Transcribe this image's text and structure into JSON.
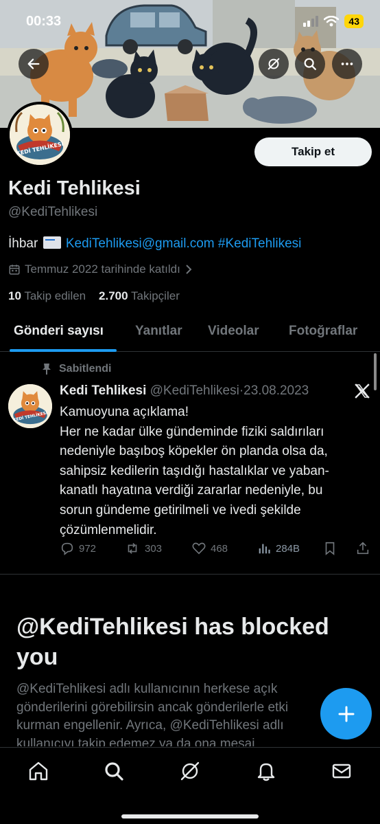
{
  "status_bar": {
    "time": "00:33",
    "battery": "43"
  },
  "profile": {
    "display_name": "Kedi Tehlikesi",
    "handle": "@KediTehlikesi",
    "bio_prefix": "İhbar",
    "bio_email": "KediTehlikesi@gmail.com",
    "bio_hashtag": "#KediTehlikesi",
    "joined": "Temmuz 2022 tarihinde katıldı",
    "following_count": "10",
    "following_label": "Takip edilen",
    "followers_count": "2.700",
    "followers_label": "Takipçiler",
    "follow_button": "Takip et",
    "avatar_logo_text": "KEDİ TEHLİKESİ"
  },
  "tabs": [
    {
      "label": "Gönderi sayısı",
      "active": true
    },
    {
      "label": "Yanıtlar",
      "active": false
    },
    {
      "label": "Videolar",
      "active": false
    },
    {
      "label": "Fotoğraflar",
      "active": false
    }
  ],
  "tweet": {
    "pinned_label": "Sabitlendi",
    "author_name": "Kedi Tehlikesi",
    "author_handle": "@KediTehlikesi",
    "separator": "·",
    "date": "23.08.2023",
    "lines": [
      "Kamuoyuna açıklama!",
      "Her ne kadar ülke gündeminde fiziki saldırıları",
      "nedeniyle başıboş köpekler ön planda olsa da,",
      "sahipsiz kedilerin taşıdığı hastalıklar ve yaban-",
      "kanatlı hayatına verdiği zararlar nedeniyle, bu",
      "sorun gündeme getirilmeli ve ivedi şekilde",
      "çözümlenmelidir."
    ],
    "replies": "972",
    "reposts": "303",
    "likes": "468",
    "views": "284B"
  },
  "blocked": {
    "title": "@KediTehlikesi has blocked you",
    "lines": [
      "@KediTehlikesi adlı kullanıcının herkese açık",
      "gönderilerini görebilirsin ancak gönderilerle etki",
      "kurman engellenir. Ayrıca, @KediTehlikesi adlı",
      "kullanıcıyı takip edemez ya da ona mesaj"
    ]
  },
  "icons": {
    "back": "back-arrow-icon",
    "grok": "grok-icon",
    "search": "search-icon",
    "more": "more-icon",
    "calendar": "calendar-icon",
    "pin": "pin-icon",
    "x_logo": "x-logo-icon",
    "reply": "reply-icon",
    "repost": "repost-icon",
    "like": "heart-icon",
    "views": "views-icon",
    "bookmark": "bookmark-icon",
    "share": "share-icon",
    "compose": "plus-icon",
    "nav": [
      "home-icon",
      "search-icon",
      "grok-icon",
      "bell-icon",
      "mail-icon"
    ]
  },
  "colors": {
    "accent": "#1d9bf0",
    "background": "#000000",
    "text": "#e7e9ea",
    "muted": "#71767b",
    "battery": "#ffd60a"
  }
}
